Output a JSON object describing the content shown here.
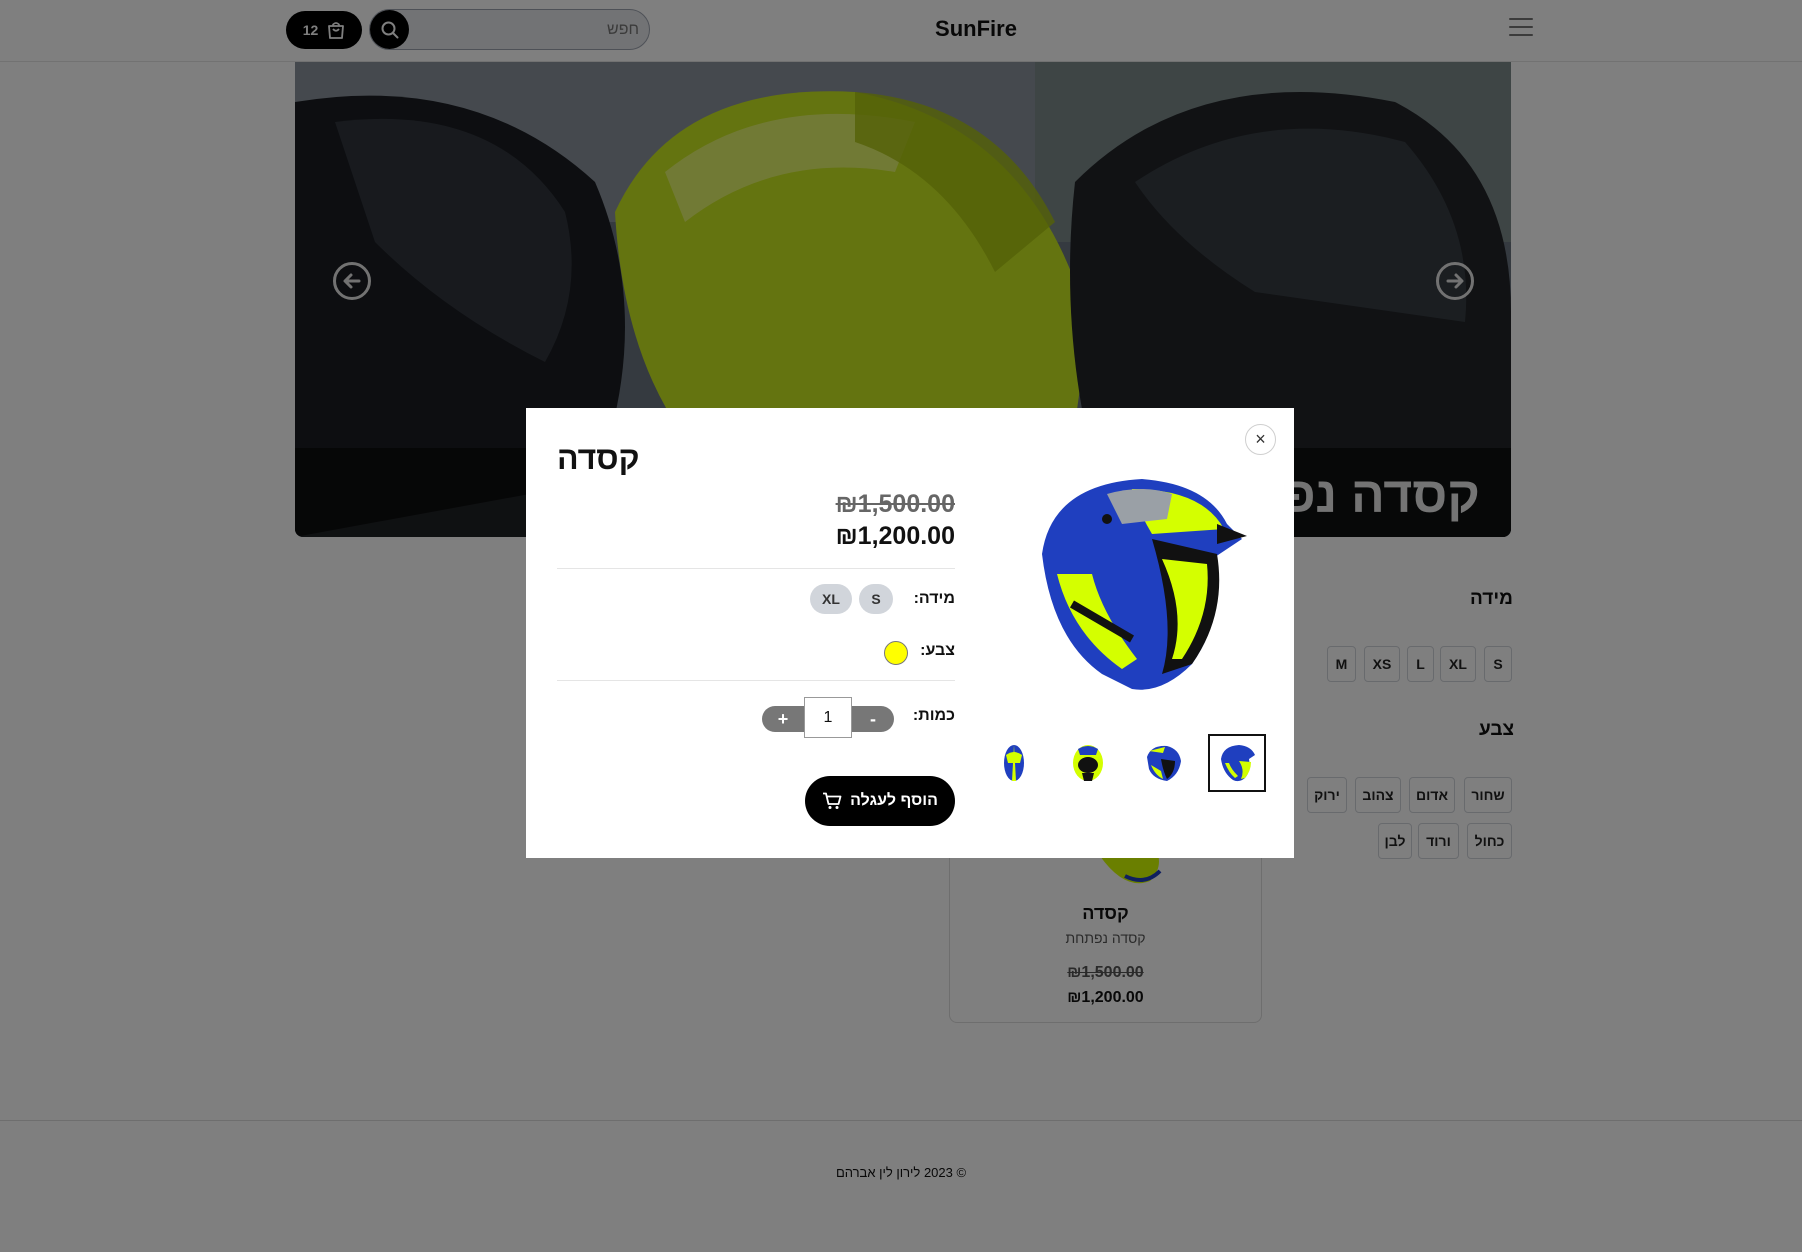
{
  "header": {
    "logo": "SunFire",
    "search_placeholder": "חפש",
    "cart_count": "12"
  },
  "hero": {
    "title": "קסדה נפתחת"
  },
  "filters": {
    "size_title": "מידה",
    "sizes": [
      "S",
      "XL",
      "L",
      "XS",
      "M"
    ],
    "color_title": "צבע",
    "colors": [
      "שחור",
      "אדום",
      "צהוב",
      "ירוק",
      "כחול",
      "ורוד",
      "לבן"
    ]
  },
  "product_card": {
    "title": "קסדה",
    "subtitle": "קסדה נפתחת",
    "old_price": "₪1,500.00",
    "new_price": "₪1,200.00"
  },
  "footer": {
    "copyright": "© 2023 לירון לין אברהם"
  },
  "modal": {
    "title": "קסדה",
    "old_price": "₪1,500.00",
    "new_price": "₪1,200.00",
    "size_label": "מידה:",
    "sizes": [
      "S",
      "XL"
    ],
    "color_label": "צבע:",
    "color_value": "#ffff00",
    "quantity_label": "כמות:",
    "quantity_value": "1",
    "minus_label": "-",
    "plus_label": "+",
    "add_to_cart_label": "הוסף לעגלה",
    "close_label": "×"
  },
  "colors": {
    "accent": "#000000",
    "overlay": "rgba(0,0,0,0.5)",
    "helmet_yellow": "#d4ff00",
    "helmet_blue": "#1f3fbf"
  }
}
